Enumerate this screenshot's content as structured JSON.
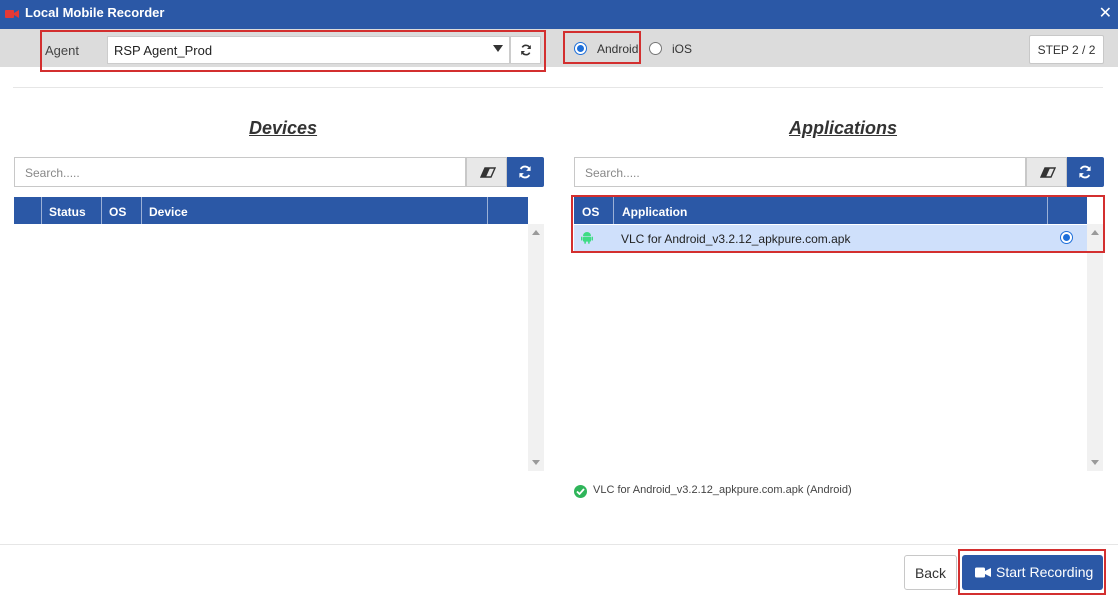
{
  "window": {
    "title": "Local Mobile Recorder",
    "close_glyph": "✕",
    "icon": "video-camera-icon",
    "accent_color": "#2b58a6",
    "highlight_color": "#d32f2f"
  },
  "toolbar": {
    "agent_label": "Agent",
    "agent_value": "RSP Agent_Prod",
    "platform_options": [
      {
        "label": "Android",
        "selected": true
      },
      {
        "label": "iOS",
        "selected": false
      }
    ],
    "step": "STEP 2 / 2"
  },
  "devices": {
    "title": "Devices",
    "search_placeholder": "Search.....",
    "columns": [
      "",
      "Status",
      "OS",
      "Device",
      ""
    ],
    "rows": []
  },
  "applications": {
    "title": "Applications",
    "search_placeholder": "Search.....",
    "columns": [
      "OS",
      "Application",
      ""
    ],
    "rows": [
      {
        "os": "android-icon",
        "application": "VLC for Android_v3.2.12_apkpure.com.apk",
        "selected": true
      }
    ],
    "selected_info": "VLC for Android_v3.2.12_apkpure.com.apk (Android)"
  },
  "footer": {
    "back_label": "Back",
    "start_label": "Start Recording"
  }
}
